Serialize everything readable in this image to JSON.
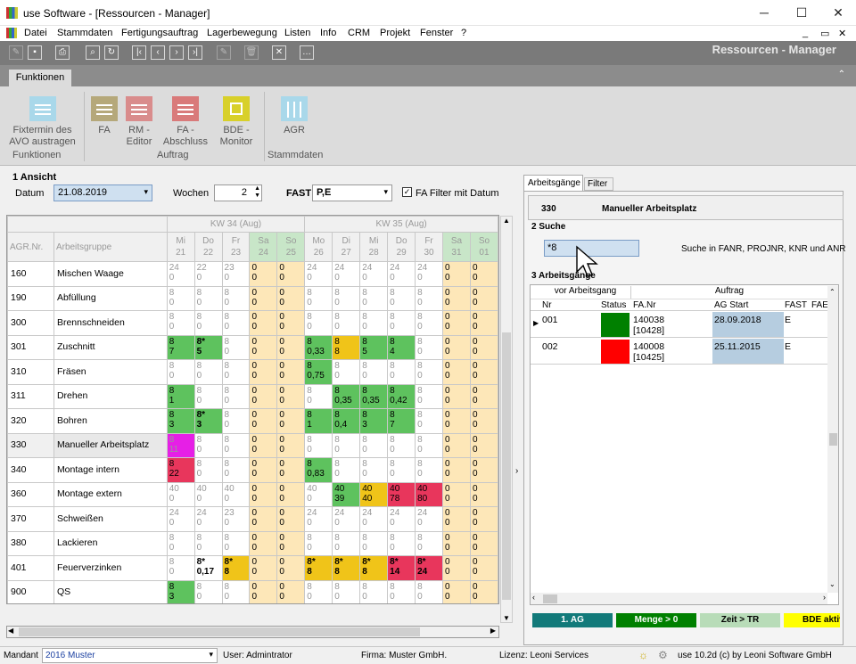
{
  "window": {
    "title": "use Software - [Ressourcen - Manager]"
  },
  "menu": [
    "Datei",
    "Stammdaten",
    "Fertigungsauftrag",
    "Lagerbewegung",
    "Listen",
    "Info",
    "CRM",
    "Projekt",
    "Fenster",
    "?"
  ],
  "toolbar_title": "Ressourcen - Manager",
  "ribbon": {
    "tab": "Funktionen",
    "buttons": [
      {
        "label": "Fixtermin des\nAVO austragen",
        "color": "#a9d8ea"
      },
      {
        "label": "FA",
        "color": "#b5a87a"
      },
      {
        "label": "RM -\nEditor",
        "color": "#d98c8c"
      },
      {
        "label": "FA -\nAbschluss",
        "color": "#d97a7a"
      },
      {
        "label": "BDE -\nMonitor",
        "color": "#d8d02a"
      },
      {
        "label": "AGR",
        "color": "#a9d8ea"
      }
    ],
    "groups": [
      "Funktionen",
      "Auftrag",
      "Stammdaten"
    ]
  },
  "ansicht": {
    "title": "1 Ansicht",
    "datum_label": "Datum",
    "datum": "21.08.2019",
    "wochen_label": "Wochen",
    "wochen": "2",
    "fast_label": "FAST",
    "fast": "P,E",
    "filter": "FA Filter mit Datum"
  },
  "grid": {
    "weeks": [
      "KW 34 (Aug)",
      "KW 35 (Aug)"
    ],
    "col_nr": "AGR.Nr.",
    "col_name": "Arbeitsgruppe",
    "days": [
      [
        "Mi",
        "21"
      ],
      [
        "Do",
        "22"
      ],
      [
        "Fr",
        "23"
      ],
      [
        "Sa",
        "24"
      ],
      [
        "So",
        "25"
      ],
      [
        "Mo",
        "26"
      ],
      [
        "Di",
        "27"
      ],
      [
        "Mi",
        "28"
      ],
      [
        "Do",
        "29"
      ],
      [
        "Fr",
        "30"
      ],
      [
        "Sa",
        "31"
      ],
      [
        "So",
        "01"
      ]
    ],
    "rows": [
      {
        "nr": "160",
        "name": "Mischen Waage",
        "cells": [
          [
            "24",
            "0",
            "w"
          ],
          [
            "22",
            "0",
            "w"
          ],
          [
            "23",
            "0",
            "w"
          ],
          [
            "0",
            "0",
            "ys"
          ],
          [
            "0",
            "0",
            "ys"
          ],
          [
            "24",
            "0",
            "w"
          ],
          [
            "24",
            "0",
            "w"
          ],
          [
            "24",
            "0",
            "w"
          ],
          [
            "24",
            "0",
            "w"
          ],
          [
            "24",
            "0",
            "w"
          ],
          [
            "0",
            "0",
            "ys"
          ],
          [
            "0",
            "0",
            "ys"
          ]
        ]
      },
      {
        "nr": "190",
        "name": "Abfüllung",
        "cells": [
          [
            "8",
            "0",
            "w"
          ],
          [
            "8",
            "0",
            "w"
          ],
          [
            "8",
            "0",
            "w"
          ],
          [
            "0",
            "0",
            "ys"
          ],
          [
            "0",
            "0",
            "ys"
          ],
          [
            "8",
            "0",
            "w"
          ],
          [
            "8",
            "0",
            "w"
          ],
          [
            "8",
            "0",
            "w"
          ],
          [
            "8",
            "0",
            "w"
          ],
          [
            "8",
            "0",
            "w"
          ],
          [
            "0",
            "0",
            "ys"
          ],
          [
            "0",
            "0",
            "ys"
          ]
        ]
      },
      {
        "nr": "300",
        "name": "Brennschneiden",
        "cells": [
          [
            "8",
            "0",
            "w"
          ],
          [
            "8",
            "0",
            "w"
          ],
          [
            "8",
            "0",
            "w"
          ],
          [
            "0",
            "0",
            "ys"
          ],
          [
            "0",
            "0",
            "ys"
          ],
          [
            "8",
            "0",
            "w"
          ],
          [
            "8",
            "0",
            "w"
          ],
          [
            "8",
            "0",
            "w"
          ],
          [
            "8",
            "0",
            "w"
          ],
          [
            "8",
            "0",
            "w"
          ],
          [
            "0",
            "0",
            "ys"
          ],
          [
            "0",
            "0",
            "ys"
          ]
        ]
      },
      {
        "nr": "301",
        "name": "Zuschnitt",
        "cells": [
          [
            "8",
            "7",
            "g"
          ],
          [
            "8*",
            "5",
            "gb"
          ],
          [
            "8",
            "0",
            "w"
          ],
          [
            "0",
            "0",
            "ys"
          ],
          [
            "0",
            "0",
            "ys"
          ],
          [
            "8",
            "0,33",
            "g"
          ],
          [
            "8",
            "8",
            "y"
          ],
          [
            "8",
            "5",
            "g"
          ],
          [
            "8",
            "4",
            "g"
          ],
          [
            "8",
            "0",
            "w"
          ],
          [
            "0",
            "0",
            "ys"
          ],
          [
            "0",
            "0",
            "ys"
          ]
        ]
      },
      {
        "nr": "310",
        "name": "Fräsen",
        "cells": [
          [
            "8",
            "0",
            "w"
          ],
          [
            "8",
            "0",
            "w"
          ],
          [
            "8",
            "0",
            "w"
          ],
          [
            "0",
            "0",
            "ys"
          ],
          [
            "0",
            "0",
            "ys"
          ],
          [
            "8",
            "0,75",
            "g"
          ],
          [
            "8",
            "0",
            "w"
          ],
          [
            "8",
            "0",
            "w"
          ],
          [
            "8",
            "0",
            "w"
          ],
          [
            "8",
            "0",
            "w"
          ],
          [
            "0",
            "0",
            "ys"
          ],
          [
            "0",
            "0",
            "ys"
          ]
        ]
      },
      {
        "nr": "311",
        "name": "Drehen",
        "cells": [
          [
            "8",
            "1",
            "g"
          ],
          [
            "8",
            "0",
            "w"
          ],
          [
            "8",
            "0",
            "w"
          ],
          [
            "0",
            "0",
            "ys"
          ],
          [
            "0",
            "0",
            "ys"
          ],
          [
            "8",
            "0",
            "w"
          ],
          [
            "8",
            "0,35",
            "g"
          ],
          [
            "8",
            "0,35",
            "g"
          ],
          [
            "8",
            "0,42",
            "g"
          ],
          [
            "8",
            "0",
            "w"
          ],
          [
            "0",
            "0",
            "ys"
          ],
          [
            "0",
            "0",
            "ys"
          ]
        ]
      },
      {
        "nr": "320",
        "name": "Bohren",
        "cells": [
          [
            "8",
            "3",
            "g"
          ],
          [
            "8*",
            "3",
            "gb"
          ],
          [
            "8",
            "0",
            "w"
          ],
          [
            "0",
            "0",
            "ys"
          ],
          [
            "0",
            "0",
            "ys"
          ],
          [
            "8",
            "1",
            "g"
          ],
          [
            "8",
            "0,4",
            "g"
          ],
          [
            "8",
            "3",
            "g"
          ],
          [
            "8",
            "7",
            "g"
          ],
          [
            "8",
            "0",
            "w"
          ],
          [
            "0",
            "0",
            "ys"
          ],
          [
            "0",
            "0",
            "ys"
          ]
        ]
      },
      {
        "nr": "330",
        "name": "Manueller Arbeitsplatz",
        "sel": true,
        "cells": [
          [
            "8",
            "11",
            "m"
          ],
          [
            "8",
            "0",
            "w"
          ],
          [
            "8",
            "0",
            "w"
          ],
          [
            "0",
            "0",
            "ys"
          ],
          [
            "0",
            "0",
            "ys"
          ],
          [
            "8",
            "0",
            "w"
          ],
          [
            "8",
            "0",
            "w"
          ],
          [
            "8",
            "0",
            "w"
          ],
          [
            "8",
            "0",
            "w"
          ],
          [
            "8",
            "0",
            "w"
          ],
          [
            "0",
            "0",
            "ys"
          ],
          [
            "0",
            "0",
            "ys"
          ]
        ]
      },
      {
        "nr": "340",
        "name": "Montage intern",
        "cells": [
          [
            "8",
            "22",
            "r"
          ],
          [
            "8",
            "0",
            "w"
          ],
          [
            "8",
            "0",
            "w"
          ],
          [
            "0",
            "0",
            "ys"
          ],
          [
            "0",
            "0",
            "ys"
          ],
          [
            "8",
            "0,83",
            "g"
          ],
          [
            "8",
            "0",
            "w"
          ],
          [
            "8",
            "0",
            "w"
          ],
          [
            "8",
            "0",
            "w"
          ],
          [
            "8",
            "0",
            "w"
          ],
          [
            "0",
            "0",
            "ys"
          ],
          [
            "0",
            "0",
            "ys"
          ]
        ]
      },
      {
        "nr": "360",
        "name": "Montage extern",
        "cells": [
          [
            "40",
            "0",
            "w"
          ],
          [
            "40",
            "0",
            "w"
          ],
          [
            "40",
            "0",
            "w"
          ],
          [
            "0",
            "0",
            "ys"
          ],
          [
            "0",
            "0",
            "ys"
          ],
          [
            "40",
            "0",
            "w"
          ],
          [
            "40",
            "39",
            "g"
          ],
          [
            "40",
            "40",
            "y"
          ],
          [
            "40",
            "78",
            "r"
          ],
          [
            "40",
            "80",
            "r"
          ],
          [
            "0",
            "0",
            "ys"
          ],
          [
            "0",
            "0",
            "ys"
          ]
        ]
      },
      {
        "nr": "370",
        "name": "Schweißen",
        "cells": [
          [
            "24",
            "0",
            "w"
          ],
          [
            "24",
            "0",
            "w"
          ],
          [
            "23",
            "0",
            "w"
          ],
          [
            "0",
            "0",
            "ys"
          ],
          [
            "0",
            "0",
            "ys"
          ],
          [
            "24",
            "0",
            "w"
          ],
          [
            "24",
            "0",
            "w"
          ],
          [
            "24",
            "0",
            "w"
          ],
          [
            "24",
            "0",
            "w"
          ],
          [
            "24",
            "0",
            "w"
          ],
          [
            "0",
            "0",
            "ys"
          ],
          [
            "0",
            "0",
            "ys"
          ]
        ]
      },
      {
        "nr": "380",
        "name": "Lackieren",
        "cells": [
          [
            "8",
            "0",
            "w"
          ],
          [
            "8",
            "0",
            "w"
          ],
          [
            "8",
            "0",
            "w"
          ],
          [
            "0",
            "0",
            "ys"
          ],
          [
            "0",
            "0",
            "ys"
          ],
          [
            "8",
            "0",
            "w"
          ],
          [
            "8",
            "0",
            "w"
          ],
          [
            "8",
            "0",
            "w"
          ],
          [
            "8",
            "0",
            "w"
          ],
          [
            "8",
            "0",
            "w"
          ],
          [
            "0",
            "0",
            "ys"
          ],
          [
            "0",
            "0",
            "ys"
          ]
        ]
      },
      {
        "nr": "401",
        "name": "Feuerverzinken",
        "cells": [
          [
            "8",
            "0",
            "w"
          ],
          [
            "8*",
            "0,17",
            "wb"
          ],
          [
            "8*",
            "8",
            "yb"
          ],
          [
            "0",
            "0",
            "ys"
          ],
          [
            "0",
            "0",
            "ys"
          ],
          [
            "8*",
            "8",
            "yb"
          ],
          [
            "8*",
            "8",
            "yb"
          ],
          [
            "8*",
            "8",
            "yb"
          ],
          [
            "8*",
            "14",
            "rb"
          ],
          [
            "8*",
            "24",
            "rb"
          ],
          [
            "0",
            "0",
            "ys"
          ],
          [
            "0",
            "0",
            "ys"
          ]
        ]
      },
      {
        "nr": "900",
        "name": "QS",
        "cells": [
          [
            "8",
            "3",
            "g"
          ],
          [
            "8",
            "0",
            "w"
          ],
          [
            "8",
            "0",
            "w"
          ],
          [
            "0",
            "0",
            "ys"
          ],
          [
            "0",
            "0",
            "ys"
          ],
          [
            "8",
            "0",
            "w"
          ],
          [
            "8",
            "0",
            "w"
          ],
          [
            "8",
            "0",
            "w"
          ],
          [
            "8",
            "0",
            "w"
          ],
          [
            "8",
            "0",
            "w"
          ],
          [
            "0",
            "0",
            "ys"
          ],
          [
            "0",
            "0",
            "ys"
          ]
        ]
      }
    ]
  },
  "right": {
    "tabs": [
      "Arbeitsgänge",
      "Filter"
    ],
    "nr": "330",
    "name": "Manueller Arbeitsplatz",
    "suche_title": "2 Suche",
    "suche_value": "*8",
    "suche_hint": "Suche in FANR, PROJNR, KNR und ANR",
    "ag_title": "3 Arbeitsgänge",
    "group_headers": [
      "vor Arbeitsgang",
      "Auftrag"
    ],
    "cols": [
      "Nr",
      "Status",
      "FA.Nr",
      "AG Start",
      "FAST",
      "FAE"
    ],
    "rows": [
      {
        "nr": "001",
        "status": "#008000",
        "fanr": "140038",
        "fanr2": "[10428]",
        "start": "28.09.2018",
        "fast": "E"
      },
      {
        "nr": "002",
        "status": "#ff0000",
        "fanr": "140008",
        "fanr2": "[10425]",
        "start": "25.11.2015",
        "fast": "E"
      }
    ],
    "legend": [
      {
        "label": "1. AG",
        "color": "#127a7a",
        "fg": "#fff"
      },
      {
        "label": "Menge > 0",
        "color": "#008000",
        "fg": "#fff"
      },
      {
        "label": "Zeit > TR",
        "color": "#b8dcb8",
        "fg": "#000"
      },
      {
        "label": "BDE aktiv",
        "color": "#ffff00",
        "fg": "#000"
      }
    ]
  },
  "status": {
    "mandant_label": "Mandant",
    "mandant": "2016 Muster",
    "user": "User: Admintrator",
    "firma": "Firma: Muster GmbH.",
    "lizenz": "Lizenz: Leoni Services",
    "version": "use 10.2d (c) by Leoni Software GmbH"
  }
}
